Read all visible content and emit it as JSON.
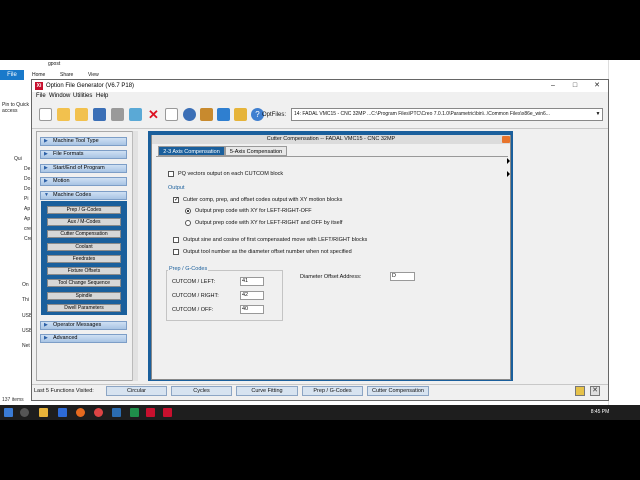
{
  "explorer": {
    "title_path": "gpost",
    "ribbon_file": "File",
    "ribbon_tabs": [
      "Home",
      "Share",
      "View"
    ],
    "nav_items": [
      "Pin to Quick access",
      "Qui",
      "De",
      "Do",
      "Do",
      "Pi",
      "Ap",
      "Ap",
      "cre",
      "Cre",
      "On",
      "Thi",
      "USB",
      "USB",
      "Net"
    ],
    "status": "137 items"
  },
  "taskbar": {
    "time": "8:45 PM"
  },
  "app": {
    "title": "Option File Generator (V6.7 P18)",
    "logo": "Xi",
    "controls": [
      "–",
      "□",
      "✕"
    ],
    "menu": [
      "File",
      "Window",
      "Utilities",
      "Help"
    ],
    "toolbar_icons": [
      "new-file-icon",
      "open-folder-icon",
      "back-icon",
      "save-icon",
      "grey-icon",
      "upload-icon",
      "delete-icon",
      "document-icon",
      "refresh-icon",
      "tools-icon",
      "swap-icon",
      "dialog-icon",
      "help-icon"
    ],
    "optfiles_label": "OptFiles:",
    "optfiles_value": "14: FADAL VMC15 - CNC 32MP ...C:\\Program Files\\PTC\\Creo 7.0.1.0\\Parametric\\bin\\..\\Common Files\\x86e_win6..."
  },
  "nav": {
    "sections": [
      "Machine Tool Type",
      "File Formats",
      "Start/End of Program",
      "Motion",
      "Machine Codes"
    ],
    "machine_codes_items": [
      "Prep / G-Codes",
      "Aux / M-Codes",
      "Cutter Compensation",
      "Coolant",
      "Feedrates",
      "Fixture Offsets",
      "Tool Change Sequence",
      "Spindle",
      "Dwell Parameters"
    ],
    "bottom_sections": [
      "Operator Messages",
      "Advanced"
    ]
  },
  "dialog": {
    "title": "Cutter Compensation  -- FADAL VMC15 - CNC 32MP",
    "tabs": [
      "2-3 Axis Compensation",
      "5-Axis Compensation"
    ],
    "pq_vectors": "PQ vectors output on each CUTCOM block",
    "output_group": "Output",
    "cutter_comp_output": "Cutter comp, prep, and offset codes output with XY motion blocks",
    "radio_lrf": "Output prep code with XY for LEFT-RIGHT-OFF",
    "radio_lr_off": "Output prep code with XY for LEFT-RIGHT and OFF by itself",
    "sine_cosine": "Output sine and cosine of first compensated move with LEFT/RIGHT blocks",
    "tool_number": "Output tool number as the diameter offset number when not specified",
    "prep_group": "Prep / G-Codes",
    "cutcom_left_label": "CUTCOM / LEFT:",
    "cutcom_left_value": "41",
    "cutcom_right_label": "CUTCOM / RIGHT:",
    "cutcom_right_value": "42",
    "cutcom_off_label": "CUTCOM / OFF:",
    "cutcom_off_value": "40",
    "diameter_label": "Diameter Offset Address:",
    "diameter_value": "D"
  },
  "bottom": {
    "last5_label": "Last 5 Functions Visited:",
    "history": [
      "Circular",
      "Cycles",
      "Curve Fitting",
      "Prep / G-Codes",
      "Cutter Compensation"
    ]
  }
}
